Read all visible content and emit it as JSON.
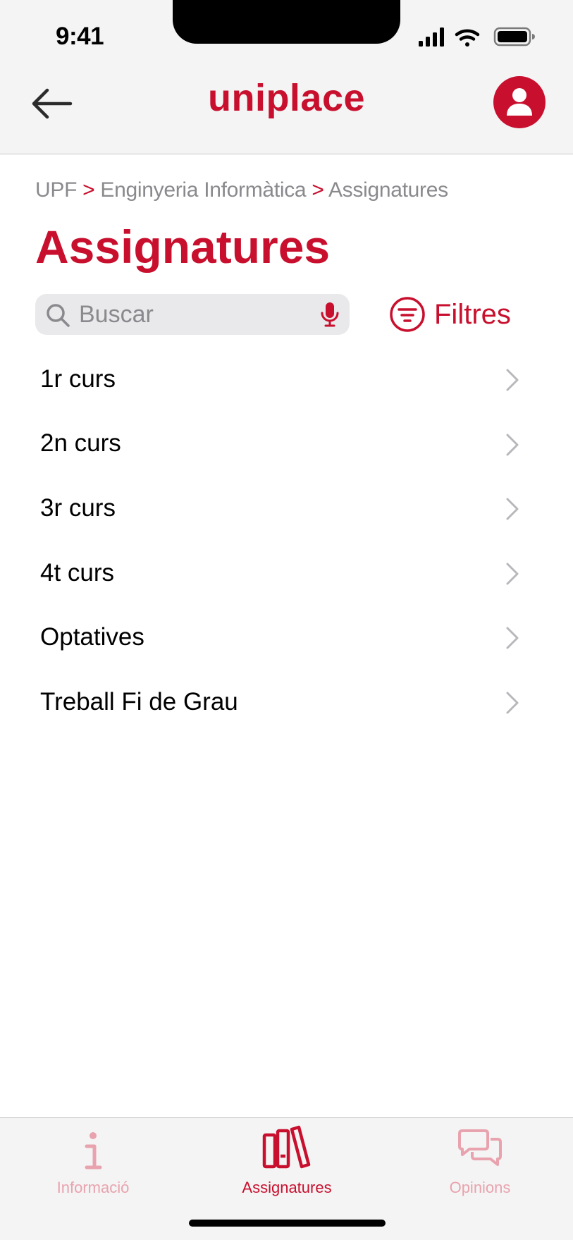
{
  "status_bar": {
    "time": "9:41"
  },
  "header": {
    "title": "uniplace"
  },
  "breadcrumb": {
    "items": [
      "UPF",
      "Enginyeria Informàtica",
      "Assignatures"
    ],
    "separator": ">"
  },
  "page": {
    "title": "Assignatures"
  },
  "search": {
    "placeholder": "Buscar",
    "value": ""
  },
  "filters": {
    "label": "Filtres"
  },
  "list": {
    "items": [
      {
        "label": "1r curs"
      },
      {
        "label": "2n curs"
      },
      {
        "label": "3r curs"
      },
      {
        "label": "4t curs"
      },
      {
        "label": "Optatives"
      },
      {
        "label": "Treball Fi de Grau"
      }
    ]
  },
  "tabbar": {
    "tabs": [
      {
        "label": "Informació",
        "icon": "info-icon",
        "active": false
      },
      {
        "label": "Assignatures",
        "icon": "books-icon",
        "active": true
      },
      {
        "label": "Opinions",
        "icon": "chat-bubbles-icon",
        "active": false
      }
    ]
  },
  "colors": {
    "accent": "#c8102e",
    "accent_inactive": "#e8a3ae",
    "bar_bg": "#f4f4f4"
  }
}
